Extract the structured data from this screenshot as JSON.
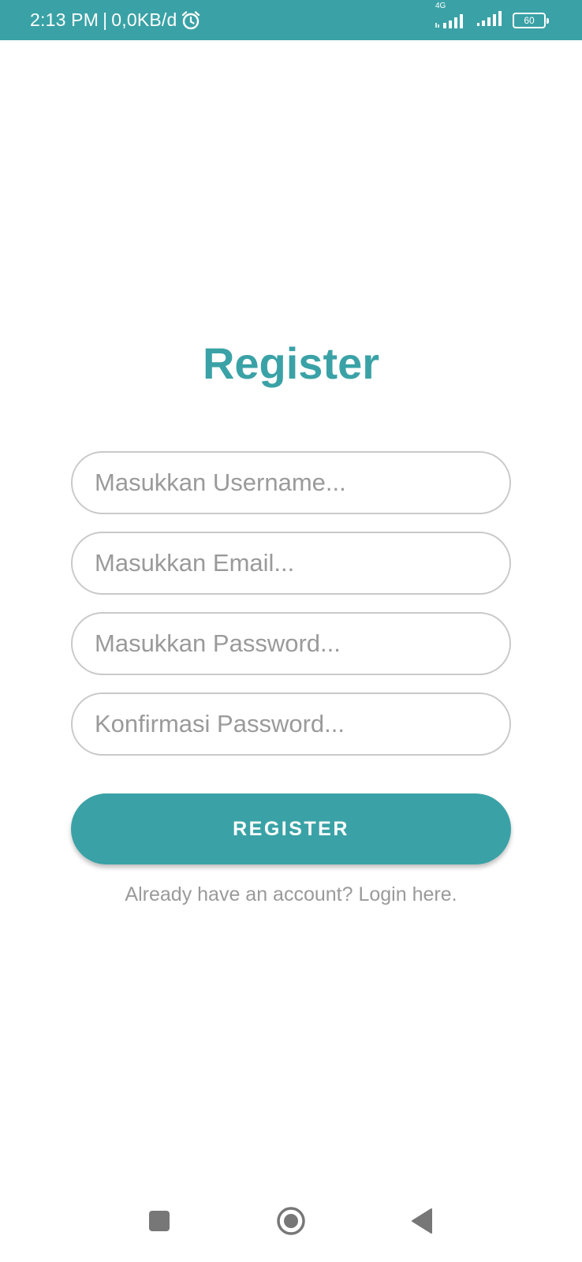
{
  "status_bar": {
    "time": "2:13 PM",
    "separator": "|",
    "data_rate": "0,0KB/d",
    "network_type": "4G",
    "battery": "60",
    "icons": [
      "alarm-icon",
      "signal-icon",
      "signal-icon",
      "battery-icon"
    ]
  },
  "register": {
    "title": "Register",
    "username_placeholder": "Masukkan Username...",
    "email_placeholder": "Masukkan Email...",
    "password_placeholder": "Masukkan Password...",
    "confirm_password_placeholder": "Konfirmasi Password...",
    "button_label": "REGISTER",
    "login_prompt": "Already have an account? Login here."
  },
  "nav_bar": {
    "icons": [
      "recents-icon",
      "home-icon",
      "back-icon"
    ]
  },
  "colors": {
    "accent": "#3aa2a6",
    "placeholder": "#9a9a9a",
    "field_border": "#c9c9c9",
    "background": "#ffffff"
  }
}
